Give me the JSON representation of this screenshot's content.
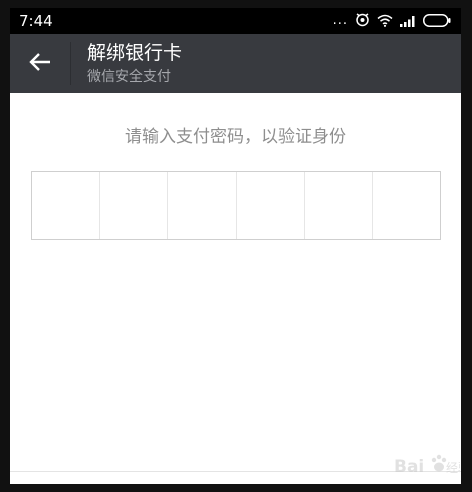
{
  "status_bar": {
    "time": "7:44",
    "dots": "...",
    "icons": [
      "more-dots-icon",
      "alarm-icon",
      "wifi-icon",
      "signal-icon",
      "battery-icon"
    ]
  },
  "app_bar": {
    "title": "解绑银行卡",
    "subtitle": "微信安全支付",
    "back_icon": "back-arrow-icon",
    "background": "#383a3f"
  },
  "main": {
    "prompt": "请输入支付密码，以验证身份",
    "pin_length": 6
  }
}
